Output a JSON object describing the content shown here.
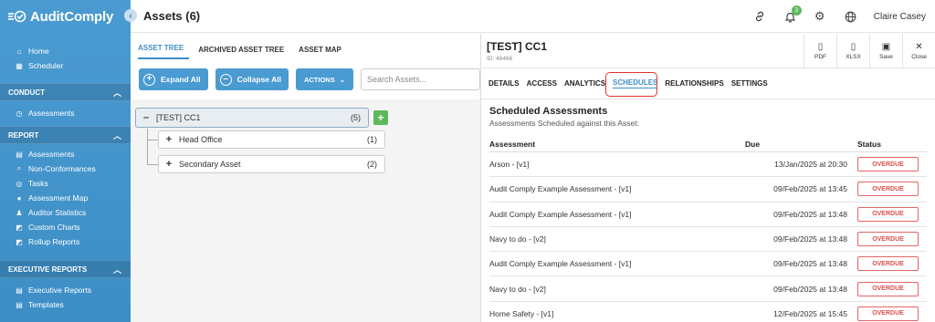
{
  "app": {
    "name": "AuditComply"
  },
  "header": {
    "title": "Assets (6)",
    "user": "Claire Casey",
    "notification_count": "3",
    "icons": [
      "link-icon",
      "bell-icon",
      "gear-icon",
      "globe-icon"
    ]
  },
  "sidebar": {
    "top_items": [
      {
        "label": "Home",
        "icon": "home-icon"
      },
      {
        "label": "Scheduler",
        "icon": "calendar-icon"
      }
    ],
    "sections": [
      {
        "title": "CONDUCT",
        "items": [
          {
            "label": "Assessments",
            "icon": "clock-icon"
          }
        ]
      },
      {
        "title": "REPORT",
        "items": [
          {
            "label": "Assessments",
            "icon": "list-icon"
          },
          {
            "label": "Non-Conformances",
            "icon": "search-icon"
          },
          {
            "label": "Tasks",
            "icon": "target-icon"
          },
          {
            "label": "Assessment Map",
            "icon": "pin-icon"
          },
          {
            "label": "Auditor Statistics",
            "icon": "user-stats-icon"
          },
          {
            "label": "Custom Charts",
            "icon": "chart-icon"
          },
          {
            "label": "Rollup Reports",
            "icon": "chart-icon"
          }
        ]
      },
      {
        "title": "EXECUTIVE REPORTS",
        "items": [
          {
            "label": "Executive Reports",
            "icon": "list-icon"
          },
          {
            "label": "Templates",
            "icon": "template-icon"
          }
        ]
      }
    ]
  },
  "tree_panel": {
    "tabs": [
      "ASSET TREE",
      "ARCHIVED ASSET TREE",
      "ASSET MAP"
    ],
    "buttons": {
      "expand": "Expand All",
      "collapse": "Collapse All",
      "actions": "ACTIONS"
    },
    "search_placeholder": "Search Assets...",
    "root": {
      "name": "[TEST] CC1",
      "count": "(5)",
      "toggle": "–"
    },
    "children": [
      {
        "name": "Head Office",
        "count": "(1)",
        "toggle": "+"
      },
      {
        "name": "Secondary Asset",
        "count": "(2)",
        "toggle": "+"
      }
    ]
  },
  "detail": {
    "asset_name": "[TEST] CC1",
    "asset_id": "ID: 46466",
    "actions": [
      {
        "label": "PDF",
        "icon": "pdf-icon"
      },
      {
        "label": "XLSX",
        "icon": "xlsx-icon"
      },
      {
        "label": "Save",
        "icon": "save-icon"
      },
      {
        "label": "Close",
        "icon": "close-icon"
      }
    ],
    "tabs": [
      "DETAILS",
      "ACCESS",
      "ANALYTICS",
      "SCHEDULES",
      "RELATIONSHIPS",
      "SETTINGS"
    ],
    "active_tab": "SCHEDULES",
    "section_title": "Scheduled Assessments",
    "section_subtitle": "Assessments Scheduled against this Asset:",
    "columns": [
      "Assessment",
      "Due",
      "Status"
    ],
    "rows": [
      {
        "assessment": "Arson - [v1]",
        "due": "13/Jan/2025 at 20:30",
        "status": "OVERDUE"
      },
      {
        "assessment": "Audit Comply Example Assessment - [v1]",
        "due": "09/Feb/2025 at 13:45",
        "status": "OVERDUE"
      },
      {
        "assessment": "Audit Comply Example Assessment - [v1]",
        "due": "09/Feb/2025 at 13:48",
        "status": "OVERDUE"
      },
      {
        "assessment": "Navy to do - [v2]",
        "due": "09/Feb/2025 at 13:48",
        "status": "OVERDUE"
      },
      {
        "assessment": "Audit Comply Example Assessment - [v1]",
        "due": "09/Feb/2025 at 13:48",
        "status": "OVERDUE"
      },
      {
        "assessment": "Navy to do - [v2]",
        "due": "09/Feb/2025 at 13:48",
        "status": "OVERDUE"
      },
      {
        "assessment": "Home Safety - [v1]",
        "due": "12/Feb/2025 at 15:45",
        "status": "OVERDUE"
      }
    ]
  },
  "colors": {
    "primary": "#4a9bd1",
    "success": "#5cb85c",
    "danger": "#d9534f",
    "highlight": "#e0332b"
  }
}
